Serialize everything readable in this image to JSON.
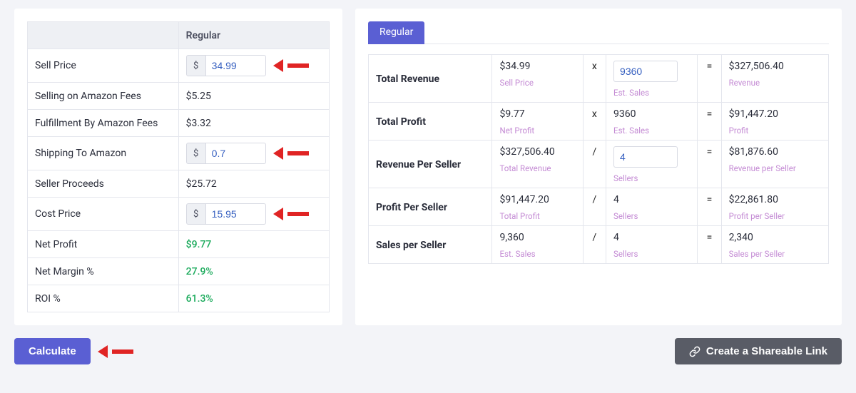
{
  "left": {
    "header_regular": "Regular",
    "rows": {
      "sell_price": {
        "label": "Sell Price",
        "value": "34.99"
      },
      "amazon_fees": {
        "label": "Selling on Amazon Fees",
        "value": "$5.25"
      },
      "fba_fees": {
        "label": "Fulfillment By Amazon Fees",
        "value": "$3.32"
      },
      "shipping": {
        "label": "Shipping To Amazon",
        "value": "0.7"
      },
      "proceeds": {
        "label": "Seller Proceeds",
        "value": "$25.72"
      },
      "cost_price": {
        "label": "Cost Price",
        "value": "15.95"
      },
      "net_profit": {
        "label": "Net Profit",
        "value": "$9.77"
      },
      "net_margin": {
        "label": "Net Margin %",
        "value": "27.9%"
      },
      "roi": {
        "label": "ROI %",
        "value": "61.3%"
      }
    },
    "currency_symbol": "$"
  },
  "right": {
    "tab": "Regular",
    "rows": {
      "total_revenue": {
        "label": "Total Revenue",
        "a": "$34.99",
        "a_sub": "Sell Price",
        "op": "x",
        "b": "9360",
        "b_sub": "Est. Sales",
        "b_input": true,
        "eq": "=",
        "c": "$327,506.40",
        "c_sub": "Revenue"
      },
      "total_profit": {
        "label": "Total Profit",
        "a": "$9.77",
        "a_sub": "Net Profit",
        "op": "x",
        "b": "9360",
        "b_sub": "Est. Sales",
        "eq": "=",
        "c": "$91,447.20",
        "c_sub": "Profit"
      },
      "revenue_per_seller": {
        "label": "Revenue Per Seller",
        "a": "$327,506.40",
        "a_sub": "Total Revenue",
        "op": "/",
        "b": "4",
        "b_sub": "Sellers",
        "b_input": true,
        "eq": "=",
        "c": "$81,876.60",
        "c_sub": "Revenue per Seller"
      },
      "profit_per_seller": {
        "label": "Profit Per Seller",
        "a": "$91,447.20",
        "a_sub": "Total Profit",
        "op": "/",
        "b": "4",
        "b_sub": "Sellers",
        "eq": "=",
        "c": "$22,861.80",
        "c_sub": "Profit per Seller"
      },
      "sales_per_seller": {
        "label": "Sales per Seller",
        "a": "9,360",
        "a_sub": "Est. Sales",
        "op": "/",
        "b": "4",
        "b_sub": "Sellers",
        "eq": "=",
        "c": "2,340",
        "c_sub": "Sales per Seller"
      }
    }
  },
  "buttons": {
    "calculate": "Calculate",
    "share": "Create a Shareable Link"
  }
}
